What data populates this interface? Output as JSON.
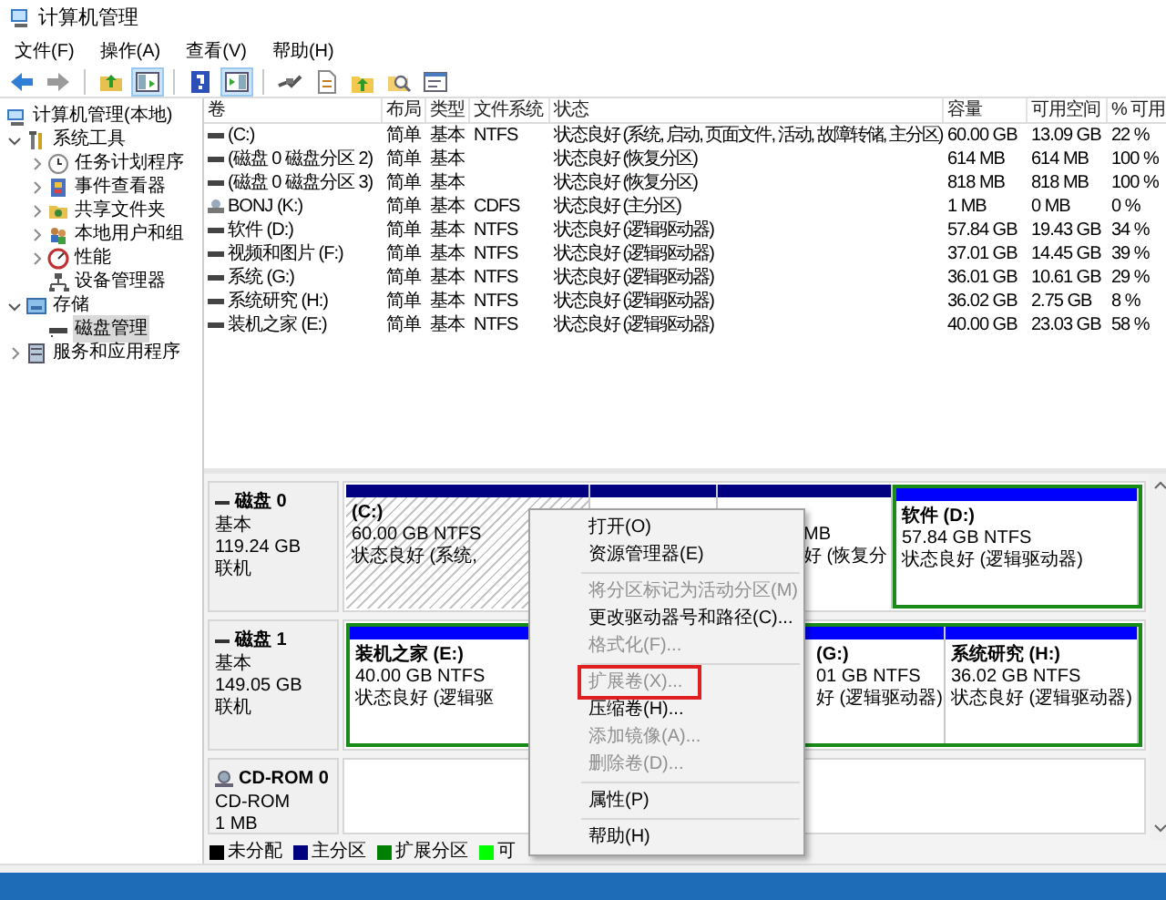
{
  "window": {
    "title": "计算机管理"
  },
  "menu": [
    "文件(F)",
    "操作(A)",
    "查看(V)",
    "帮助(H)"
  ],
  "toolbar": [
    [
      {
        "kind": "back",
        "pressed": false
      },
      {
        "kind": "forward",
        "pressed": false
      }
    ],
    [
      {
        "kind": "up",
        "pressed": false
      },
      {
        "kind": "tree",
        "pressed": true
      }
    ],
    [
      {
        "kind": "help",
        "pressed": false
      },
      {
        "kind": "pane",
        "pressed": true
      }
    ],
    [
      {
        "kind": "connect",
        "pressed": false
      },
      {
        "kind": "check",
        "pressed": false
      },
      {
        "kind": "export",
        "pressed": false
      },
      {
        "kind": "search",
        "pressed": false
      },
      {
        "kind": "properties",
        "pressed": false
      }
    ]
  ],
  "tree": [
    {
      "label": "计算机管理(本地)",
      "selected": false,
      "children": [
        {
          "label": "系统工具",
          "expanded": true,
          "selected": false,
          "children": [
            {
              "label": "任务计划程序",
              "expanded": false,
              "selected": false
            },
            {
              "label": "事件查看器",
              "expanded": false,
              "selected": false
            },
            {
              "label": "共享文件夹",
              "expanded": false,
              "selected": false
            },
            {
              "label": "本地用户和组",
              "expanded": false,
              "selected": false
            },
            {
              "label": "性能",
              "expanded": false,
              "selected": false
            },
            {
              "label": "设备管理器",
              "selected": false
            }
          ]
        },
        {
          "label": "存储",
          "expanded": true,
          "selected": false,
          "children": [
            {
              "label": "磁盘管理",
              "selected": true
            }
          ]
        },
        {
          "label": "服务和应用程序",
          "expanded": false,
          "selected": false
        }
      ]
    }
  ],
  "table": {
    "columns": [
      "卷",
      "布局",
      "类型",
      "文件系统",
      "状态",
      "容量",
      "可用空间",
      "% 可用"
    ],
    "rows": [
      {
        "kind": "disk",
        "volume": "(C:)",
        "layout": "简单",
        "type": "基本",
        "fs": "NTFS",
        "status": "状态良好 (系统, 启动, 页面文件, 活动, 故障转储, 主分区)",
        "capacity": "60.00 GB",
        "free": "13.09 GB",
        "percent": "22 %"
      },
      {
        "kind": "disk",
        "volume": "(磁盘 0 磁盘分区 2)",
        "layout": "简单",
        "type": "基本",
        "status": "状态良好 (恢复分区)",
        "capacity": "614 MB",
        "free": "614 MB",
        "percent": "100 %"
      },
      {
        "kind": "disk",
        "volume": "(磁盘 0 磁盘分区 3)",
        "layout": "简单",
        "type": "基本",
        "status": "状态良好 (恢复分区)",
        "capacity": "818 MB",
        "free": "818 MB",
        "percent": "100 %"
      },
      {
        "kind": "cdrom",
        "volume": "BONJ (K:)",
        "layout": "简单",
        "type": "基本",
        "fs": "CDFS",
        "status": "状态良好 (主分区)",
        "capacity": "1 MB",
        "free": "0 MB",
        "percent": "0 %"
      },
      {
        "kind": "disk",
        "volume": "软件 (D:)",
        "layout": "简单",
        "type": "基本",
        "fs": "NTFS",
        "status": "状态良好 (逻辑驱动器)",
        "capacity": "57.84 GB",
        "free": "19.43 GB",
        "percent": "34 %"
      },
      {
        "kind": "disk",
        "volume": "视频和图片 (F:)",
        "layout": "简单",
        "type": "基本",
        "fs": "NTFS",
        "status": "状态良好 (逻辑驱动器)",
        "capacity": "37.01 GB",
        "free": "14.45 GB",
        "percent": "39 %"
      },
      {
        "kind": "disk",
        "volume": "系统 (G:)",
        "layout": "简单",
        "type": "基本",
        "fs": "NTFS",
        "status": "状态良好 (逻辑驱动器)",
        "capacity": "36.01 GB",
        "free": "10.61 GB",
        "percent": "29 %"
      },
      {
        "kind": "disk",
        "volume": "系统研究 (H:)",
        "layout": "简单",
        "type": "基本",
        "fs": "NTFS",
        "status": "状态良好 (逻辑驱动器)",
        "capacity": "36.02 GB",
        "free": "2.75 GB",
        "percent": "8 %"
      },
      {
        "kind": "disk",
        "volume": "装机之家 (E:)",
        "layout": "简单",
        "type": "基本",
        "fs": "NTFS",
        "status": "状态良好 (逻辑驱动器)",
        "capacity": "40.00 GB",
        "free": "23.03 GB",
        "percent": "58 %"
      }
    ]
  },
  "disks": [
    {
      "kind": "disk",
      "name": "磁盘 0",
      "lines": [
        "基本",
        "119.24 GB",
        "联机"
      ],
      "partitions": [
        {
          "kind": "primary",
          "hatched": true,
          "title": "(C:)",
          "lines": [
            "60.00 GB NTFS",
            "状态良好 (系统,"
          ]
        },
        {
          "kind": "primary",
          "hatched": false
        },
        {
          "kind": "primary",
          "hatched": false,
          "lines": [
            "MB",
            "好 (恢复分"
          ]
        },
        {
          "kind": "logical",
          "hatched": false,
          "title": "软件  (D:)",
          "lines": [
            "57.84 GB NTFS",
            "状态良好 (逻辑驱动器)"
          ]
        }
      ]
    },
    {
      "kind": "disk",
      "name": "磁盘 1",
      "lines": [
        "基本",
        "149.05 GB",
        "联机"
      ],
      "partitions": [
        {
          "kind": "logical",
          "hatched": false,
          "title": "装机之家  (E:)",
          "lines": [
            "40.00 GB NTFS",
            "状态良好 (逻辑驱"
          ]
        },
        {
          "kind": "logical",
          "hatched": false,
          "title": "(G:)",
          "lines": [
            "01 GB NTFS",
            "好 (逻辑驱动器)"
          ]
        },
        {
          "kind": "logical",
          "hatched": false,
          "title": "系统研究  (H:)",
          "lines": [
            "36.02 GB NTFS",
            "状态良好 (逻辑驱动器)"
          ]
        }
      ]
    },
    {
      "kind": "cdrom",
      "name": "CD-ROM 0",
      "lines": [
        "CD-ROM",
        "1 MB"
      ]
    }
  ],
  "legend": [
    {
      "label": "未分配",
      "color": "#000000"
    },
    {
      "label": "主分区",
      "color": "#000080"
    },
    {
      "label": "扩展分区",
      "color": "#008000"
    },
    {
      "label": "可",
      "color": "#00ff00"
    }
  ],
  "context_menu": [
    {
      "kind": "item",
      "label": "打开(O)",
      "disabled": false,
      "highlighted": false
    },
    {
      "kind": "item",
      "label": "资源管理器(E)",
      "disabled": false,
      "highlighted": false
    },
    {
      "kind": "separator"
    },
    {
      "kind": "item",
      "label": "将分区标记为活动分区(M)",
      "disabled": true,
      "highlighted": false
    },
    {
      "kind": "item",
      "label": "更改驱动器号和路径(C)...",
      "disabled": false,
      "highlighted": false
    },
    {
      "kind": "item",
      "label": "格式化(F)...",
      "disabled": true,
      "highlighted": false
    },
    {
      "kind": "separator"
    },
    {
      "kind": "item",
      "label": "扩展卷(X)...",
      "disabled": true,
      "highlighted": true
    },
    {
      "kind": "item",
      "label": "压缩卷(H)...",
      "disabled": false,
      "highlighted": false
    },
    {
      "kind": "item",
      "label": "添加镜像(A)...",
      "disabled": true,
      "highlighted": false
    },
    {
      "kind": "item",
      "label": "删除卷(D)...",
      "disabled": true,
      "highlighted": false
    },
    {
      "kind": "separator"
    },
    {
      "kind": "item",
      "label": "属性(P)",
      "disabled": false,
      "highlighted": false
    },
    {
      "kind": "separator"
    },
    {
      "kind": "item",
      "label": "帮助(H)",
      "disabled": false,
      "highlighted": false
    }
  ]
}
